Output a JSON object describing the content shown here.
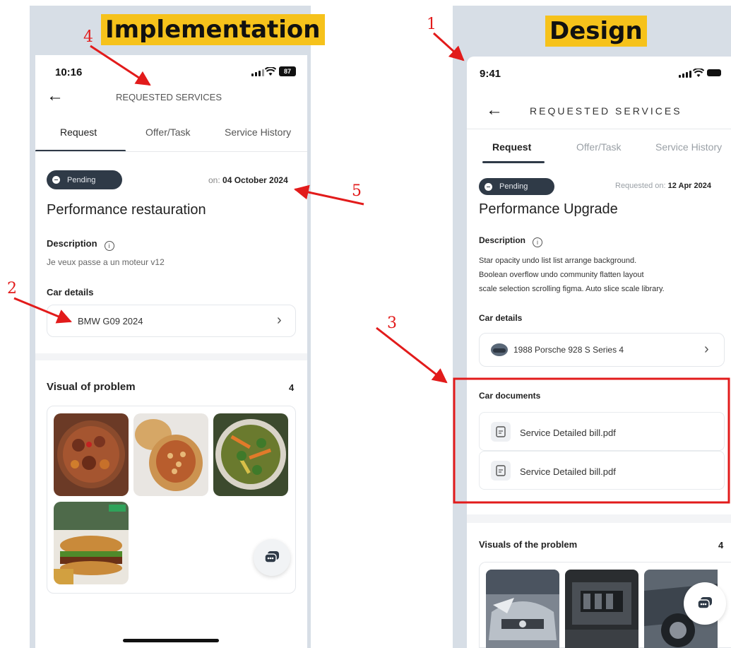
{
  "labels": {
    "implementation": "Implementation",
    "design": "Design"
  },
  "annotations": [
    "1",
    "2",
    "3",
    "4",
    "5"
  ],
  "implementation": {
    "status_time": "10:16",
    "battery": "87",
    "header_title": "REQUESTED SERVICES",
    "tabs": [
      "Request",
      "Offer/Task",
      "Service History"
    ],
    "status_badge": "Pending",
    "date_prefix": "on:",
    "date_value": "04 October 2024",
    "title": "Performance restauration",
    "description_label": "Description",
    "description_text": "Je veux passe a un moteur v12",
    "car_details_label": "Car details",
    "car_name": "BMW G09 2024",
    "visual_label": "Visual of problem",
    "visual_count": "4"
  },
  "design": {
    "status_time": "9:41",
    "header_title": "REQUESTED SERVICES",
    "tabs": [
      "Request",
      "Offer/Task",
      "Service History"
    ],
    "status_badge": "Pending",
    "date_prefix": "Requested on:",
    "date_value": "12 Apr 2024",
    "title": "Performance Upgrade",
    "description_label": "Description",
    "description_lines": [
      "Star opacity undo list list arrange background.",
      "Boolean overflow undo community flatten layout",
      "scale selection scrolling figma. Auto slice scale library."
    ],
    "car_details_label": "Car details",
    "car_name": "1988 Porsche 928 S Series 4",
    "documents_label": "Car documents",
    "documents": [
      "Service Detailed bill.pdf",
      "Service Detailed bill.pdf"
    ],
    "visual_label": "Visuals of the problem",
    "visual_count": "4"
  },
  "icons": [
    "back-arrow-icon",
    "info-icon",
    "chevron-right-icon",
    "document-icon",
    "chat-icon",
    "signal-icon",
    "wifi-icon",
    "battery-icon"
  ],
  "colors": {
    "annotation": "#e21b1b",
    "highlight": "#f6c21b",
    "badge": "#2f3a47",
    "background": "#d7dee6"
  }
}
